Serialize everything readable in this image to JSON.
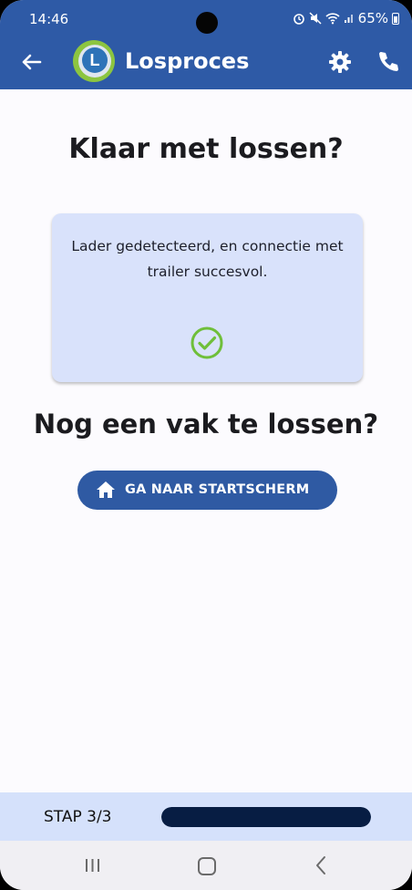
{
  "status_bar": {
    "time": "14:46",
    "battery": "65%"
  },
  "app_bar": {
    "title": "Losproces",
    "logo_letter": "L",
    "icons": [
      "back-arrow-icon",
      "logo",
      "settings-gear-icon",
      "phone-icon"
    ]
  },
  "main": {
    "heading": "Klaar met lossen?",
    "card_text": "Lader gedetecteerd, en connectie met trailer succesvol.",
    "question": "Nog een vak te lossen?",
    "home_button_label": "GA NAAR STARTSCHERM"
  },
  "step": {
    "label": "STAP 3/3",
    "progress": 1.0
  },
  "colors": {
    "primary": "#2e5aa6",
    "card_bg": "#d9e2fb",
    "success": "#6fbf3a",
    "progress_fill": "#071d43"
  }
}
